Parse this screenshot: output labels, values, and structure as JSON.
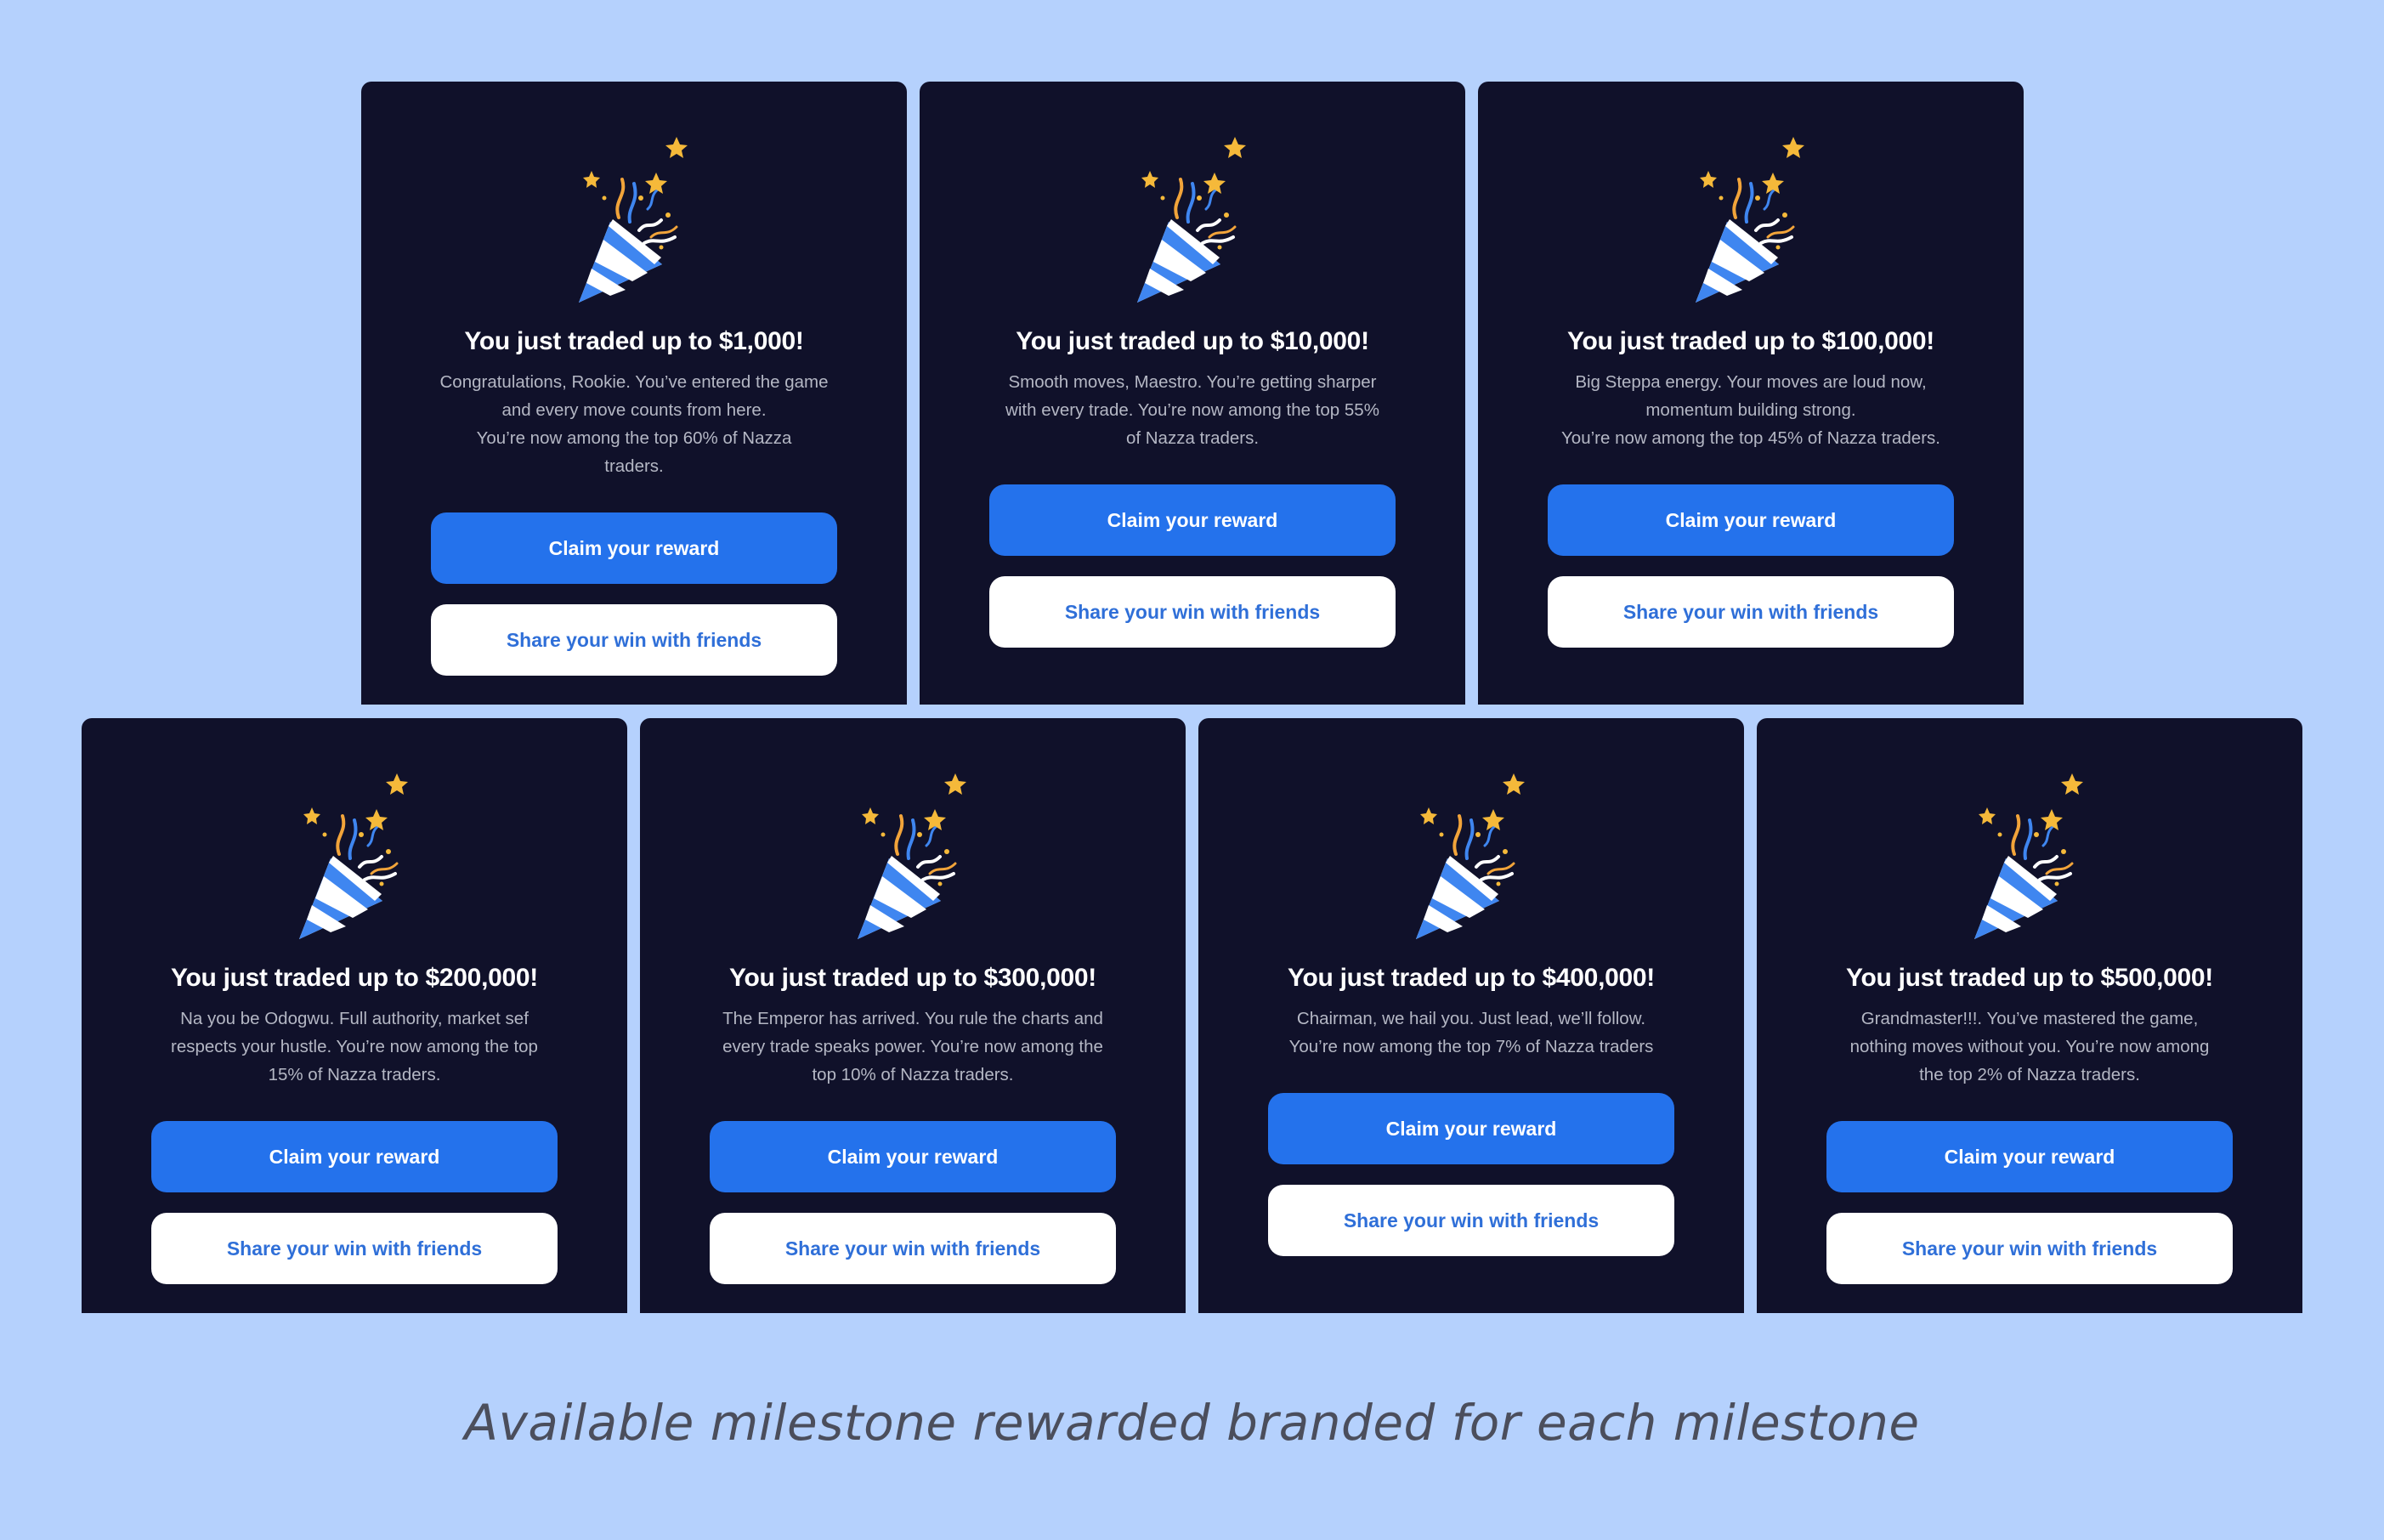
{
  "colors": {
    "page_background": "#b5d1fd",
    "card_background": "#10112a",
    "primary_button": "#2472ec",
    "secondary_button_text": "#2f6fd8"
  },
  "icon": "party-popper-icon",
  "cards": [
    {
      "title": "You just traded up to $1,000!",
      "lines": [
        "Congratulations, Rookie. You’ve entered the game",
        "and every move counts from here.",
        "You’re now among the top 60% of Nazza",
        "traders."
      ],
      "primary_label": "Claim your reward",
      "secondary_label": "Share your win with friends"
    },
    {
      "title": "You just traded up to $10,000!",
      "lines": [
        "Smooth moves, Maestro. You’re getting sharper",
        "with every trade. You’re now among the top 55%",
        "of Nazza traders."
      ],
      "primary_label": "Claim your reward",
      "secondary_label": "Share your win with friends"
    },
    {
      "title": "You just traded up to $100,000!",
      "lines": [
        "Big Steppa energy. Your moves are loud now,",
        "momentum building strong.",
        "You’re now among the top 45% of Nazza traders."
      ],
      "primary_label": "Claim your reward",
      "secondary_label": "Share your win with friends"
    },
    {
      "title": "You just traded up to $200,000!",
      "lines": [
        "Na you be Odogwu. Full authority, market sef",
        "respects your hustle. You’re now among the top",
        "15% of Nazza traders."
      ],
      "primary_label": "Claim your reward",
      "secondary_label": "Share your win with friends"
    },
    {
      "title": "You just traded up to $300,000!",
      "lines": [
        "The Emperor has arrived. You rule the charts and",
        "every trade speaks power. You’re now among the",
        "top 10% of Nazza traders."
      ],
      "primary_label": "Claim your reward",
      "secondary_label": "Share your win with friends"
    },
    {
      "title": "You just traded up to $400,000!",
      "lines": [
        "Chairman, we hail you. Just lead, we’ll follow.",
        "You’re now among the top 7% of Nazza traders"
      ],
      "primary_label": "Claim your reward",
      "secondary_label": "Share your win with friends"
    },
    {
      "title": "You just traded up to $500,000!",
      "lines": [
        "Grandmaster!!!. You’ve mastered the game,",
        "nothing moves without you. You’re now among",
        "the top 2% of Nazza traders."
      ],
      "primary_label": "Claim your reward",
      "secondary_label": "Share your win with friends"
    }
  ],
  "caption": "Available milestone rewarded branded for each milestone"
}
